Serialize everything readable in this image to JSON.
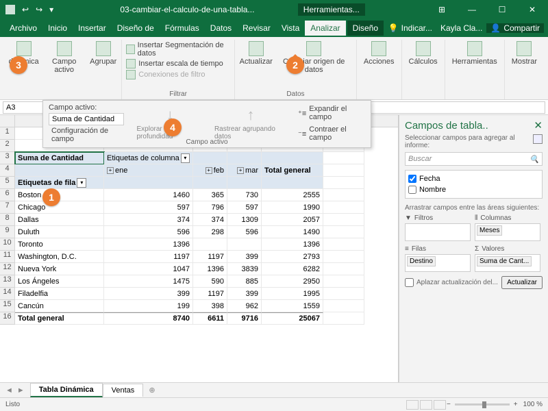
{
  "title": "03-cambiar-el-calculo-de-una-tabla...",
  "contextual": "Herramientas...",
  "user": "Kayla Cla...",
  "share": "Compartir",
  "tell_me": "Indicar...",
  "menu": [
    "Archivo",
    "Inicio",
    "Insertar",
    "Diseño de",
    "Fórmulas",
    "Datos",
    "Revisar",
    "Vista",
    "Analizar",
    "Diseño"
  ],
  "active_menu": "Analizar",
  "ribbon": {
    "dinamica": "dinámica",
    "campo_activo": "Campo\nactivo",
    "agrupar": "Agrupar",
    "seg": "Insertar Segmentación de datos",
    "escala": "Insertar escala de tiempo",
    "conex": "Conexiones de filtro",
    "filtrar": "Filtrar",
    "actualizar": "Actualizar",
    "cambiar": "Cambiar origen\nde datos",
    "datos": "Datos",
    "acciones": "Acciones",
    "calculos": "Cálculos",
    "herramientas": "Herramientas",
    "mostrar": "Mostrar"
  },
  "dropdown": {
    "label": "Campo activo:",
    "value": "Suma de Cantidad",
    "config": "Configuración de campo",
    "explorar": "Explorar en\nprofundidad",
    "rastrear": "Rastrear agrupando\ndatos",
    "expandir": "Expandir el campo",
    "contraer": "Contraer el campo",
    "group": "Campo activo"
  },
  "namebox": "A3",
  "pivot": {
    "corner": "Suma de Cantidad",
    "colhdr": "Etiquetas de columna",
    "rowhdr": "Etiquetas de fila",
    "months": [
      "ene",
      "feb",
      "mar"
    ],
    "total_col": "Total general",
    "total_row": "Total general",
    "rows": [
      {
        "city": "Boston",
        "v": [
          "1460",
          "365",
          "730",
          "2555"
        ]
      },
      {
        "city": "Chicago",
        "v": [
          "597",
          "796",
          "597",
          "1990"
        ]
      },
      {
        "city": "Dallas",
        "v": [
          "374",
          "374",
          "1309",
          "2057"
        ]
      },
      {
        "city": "Duluth",
        "v": [
          "596",
          "298",
          "596",
          "1490"
        ]
      },
      {
        "city": "Toronto",
        "v": [
          "1396",
          "",
          "",
          "1396"
        ]
      },
      {
        "city": "Washington, D.C.",
        "v": [
          "1197",
          "1197",
          "399",
          "2793"
        ]
      },
      {
        "city": "Nueva York",
        "v": [
          "1047",
          "1396",
          "3839",
          "6282"
        ]
      },
      {
        "city": "Los Ángeles",
        "v": [
          "1475",
          "590",
          "885",
          "2950"
        ]
      },
      {
        "city": "Filadelfia",
        "v": [
          "399",
          "1197",
          "399",
          "1995"
        ]
      },
      {
        "city": "Cancún",
        "v": [
          "199",
          "398",
          "962",
          "1559"
        ]
      }
    ],
    "totals": [
      "8740",
      "6611",
      "9716",
      "25067"
    ]
  },
  "fieldpane": {
    "title": "Campos de tabla..",
    "sub": "Seleccionar campos para agregar al informe:",
    "search": "Buscar",
    "fields": [
      {
        "name": "Fecha",
        "checked": true
      },
      {
        "name": "Nombre",
        "checked": false
      }
    ],
    "drag": "Arrastrar campos entre las áreas siguientes:",
    "filtros": "Filtros",
    "columnas": "Columnas",
    "filas": "Filas",
    "valores": "Valores",
    "col_tag": "Meses",
    "row_tag": "Destino",
    "val_tag": "Suma de Cant...",
    "defer": "Aplazar actualización del...",
    "update": "Actualizar"
  },
  "sheets": {
    "s1": "Tabla Dinámica",
    "s2": "Ventas"
  },
  "status": {
    "ready": "Listo",
    "zoom": "100 %"
  }
}
